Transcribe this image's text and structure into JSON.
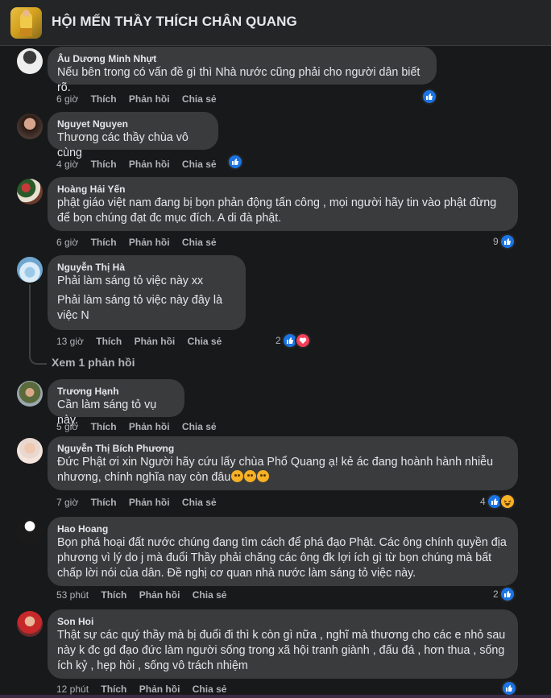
{
  "group": {
    "title": "HỘI MẾN THẦY THÍCH CHÂN QUANG"
  },
  "actions": {
    "like": "Thích",
    "reply": "Phản hồi",
    "share": "Chia sẻ"
  },
  "comments": [
    {
      "author": "Âu Dương Minh Nhựt",
      "lines": [
        "Nếu bên trong có vấn đề gì thì Nhà nước cũng phải cho người dân biết rõ."
      ],
      "time": "6 giờ",
      "reactions": {
        "count": "",
        "types": [
          "like"
        ]
      }
    },
    {
      "author": "Nguyet Nguyen",
      "lines": [
        "Thương các thầy chùa vô cùng"
      ],
      "time": "4 giờ",
      "reactions": {
        "count": "",
        "types": [
          "like"
        ]
      }
    },
    {
      "author": "Hoàng Hải Yến",
      "lines": [
        "phật giáo việt nam đang bị bọn phản động tấn công , mọi người hãy tin vào phật đừng để bọn chúng đạt đc mục đích. A di đà phật."
      ],
      "time": "6 giờ",
      "reactions": {
        "count": "9",
        "types": [
          "like"
        ]
      }
    },
    {
      "author": "Nguyễn Thị Hà",
      "lines": [
        "Phải làm sáng tỏ việc này xx",
        "Phải làm sáng tỏ việc này đây là việc N"
      ],
      "time": "13 giờ",
      "reactions": {
        "count": "2",
        "types": [
          "like",
          "love"
        ]
      },
      "view_replies": "Xem 1 phản hồi"
    },
    {
      "author": "Trương Hạnh",
      "lines": [
        "Cần làm sáng tỏ vụ này."
      ],
      "time": "5 giờ",
      "reactions": {
        "count": "",
        "types": []
      }
    },
    {
      "author": "Nguyễn Thị Bích Phương",
      "lines": [
        "Đức Phật ơi xin Người hãy cứu lấy chùa Phổ Quang ạ! kẻ ác đang hoành hành nhiễu nhương, chính nghĩa nay còn đâu"
      ],
      "time": "7 giờ",
      "reactions": {
        "count": "4",
        "types": [
          "like",
          "haha"
        ]
      }
    },
    {
      "author": "Hao Hoang",
      "lines": [
        "Bọn phá hoại đất nước chúng đang tìm cách để phá đạo Phật. Các ông chính quyền địa phương vì lý do j mà đuổi Thầy phải chăng các ông đk lợi ích gì từ bọn chúng mà bất chấp lời nói của dân. Đề nghị cơ quan nhà nước làm sáng tỏ việc này."
      ],
      "time": "53 phút",
      "reactions": {
        "count": "2",
        "types": [
          "like"
        ]
      }
    },
    {
      "author": "Son Hoi",
      "lines": [
        "Thật sự các quý thầy mà bị đuổi đi thì k còn gì nữa , nghĩ mà thương cho các e nhỏ sau này k đc gd đạo đức làm người sống trong xã hội tranh giành , đấu đá , hơn thua , sống ích kỷ , hẹp hòi , sống vô trách nhiệm"
      ],
      "time": "12 phút",
      "reactions": {
        "count": "",
        "types": [
          "like"
        ]
      }
    }
  ]
}
